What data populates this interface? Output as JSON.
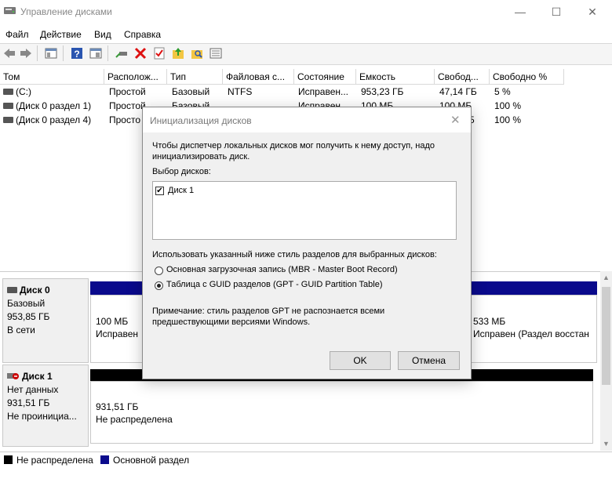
{
  "window": {
    "title": "Управление дисками",
    "minimize": "—",
    "maximize": "☐",
    "close": "✕"
  },
  "menu": [
    "Файл",
    "Действие",
    "Вид",
    "Справка"
  ],
  "columns": [
    "Том",
    "Располож...",
    "Тип",
    "Файловая с...",
    "Состояние",
    "Емкость",
    "Свобод...",
    "Свободно %"
  ],
  "volumes": [
    [
      "(C:)",
      "Простой",
      "Базовый",
      "NTFS",
      "Исправен...",
      "953,23 ГБ",
      "47,14 ГБ",
      "5 %"
    ],
    [
      "(Диск 0 раздел 1)",
      "Простой",
      "Базовый",
      "",
      "Исправен...",
      "100 МБ",
      "100 МБ",
      "100 %"
    ],
    [
      "(Диск 0 раздел 4)",
      "Просто",
      "",
      "",
      "",
      "",
      "5",
      "100 %"
    ]
  ],
  "disk0": {
    "name": "Диск 0",
    "type": "Базовый",
    "size": "953,85 ГБ",
    "status": "В сети",
    "part1_size": "100 МБ",
    "part1_status": "Исправен",
    "part4_size": "533 МБ",
    "part4_status": "Исправен (Раздел восстан"
  },
  "disk1": {
    "name": "Диск 1",
    "type": "Нет данных",
    "size": "931,51 ГБ",
    "status": "Не проинициа...",
    "part_size": "931,51 ГБ",
    "part_status": "Не распределена"
  },
  "legend": {
    "unallocated": "Не распределена",
    "primary": "Основной раздел"
  },
  "dialog": {
    "title": "Инициализация дисков",
    "intro_line1": "Чтобы диспетчер локальных дисков мог получить к нему доступ, надо",
    "intro_line2": "инициализировать диск.",
    "select_label": "Выбор дисков:",
    "disk_item": "Диск 1",
    "style_label": "Использовать указанный ниже стиль разделов для выбранных дисков:",
    "mbr_option": "Основная загрузочная запись (MBR - Master Boot Record)",
    "gpt_option": "Таблица с GUID разделов (GPT - GUID Partition Table)",
    "note_line1": "Примечание: стиль разделов GPT не распознается всеми",
    "note_line2": "предшествующими версиями Windows.",
    "ok": "OK",
    "cancel": "Отмена",
    "selected_style": "GPT",
    "disk_checked": true
  },
  "colors": {
    "primary_partition": "#0a0a8c",
    "unallocated": "#000000"
  }
}
